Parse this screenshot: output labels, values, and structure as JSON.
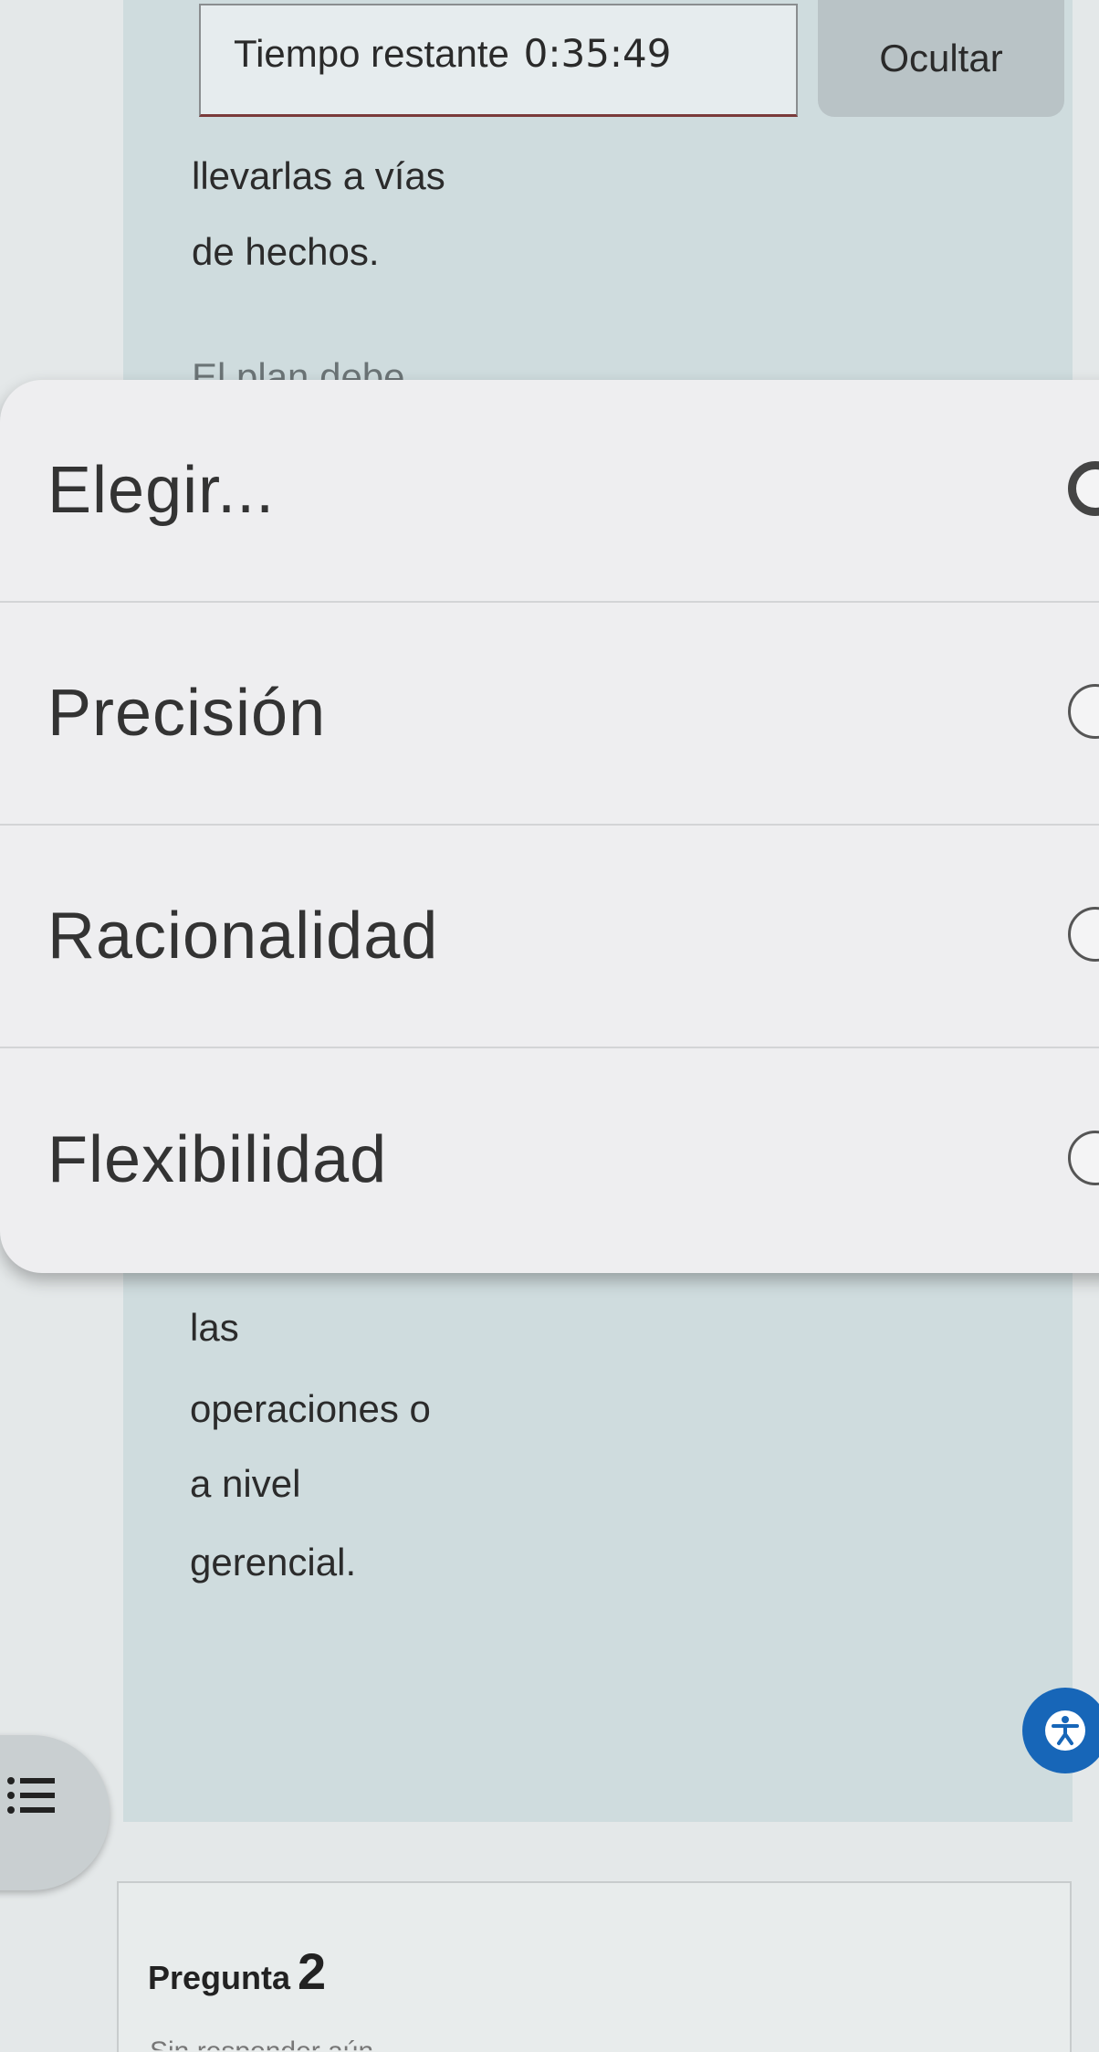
{
  "timer": {
    "label": "Tiempo restante",
    "value": "0:35:49"
  },
  "hide_button_label": "Ocultar",
  "question": {
    "text_lines_above": [
      "llevarlas a vías",
      "de hechos."
    ],
    "partial_line": "El plan debe",
    "text_lines_below": [
      "las",
      "operaciones o",
      "a nivel",
      "gerencial."
    ]
  },
  "dropdown": {
    "options": [
      {
        "label": "Elegir...",
        "selected": true
      },
      {
        "label": "Precisión",
        "selected": false
      },
      {
        "label": "Racionalidad",
        "selected": false
      },
      {
        "label": "Flexibilidad",
        "selected": false
      }
    ]
  },
  "next_question": {
    "label": "Pregunta",
    "number": "2",
    "status": "Sin responder aún"
  },
  "colors": {
    "panel": "#cfdcde",
    "accessibility_button": "#1766b8",
    "dropdown_bg": "#eeeef0"
  },
  "icons": {
    "accessibility": "accessibility-icon",
    "list": "list-icon"
  }
}
